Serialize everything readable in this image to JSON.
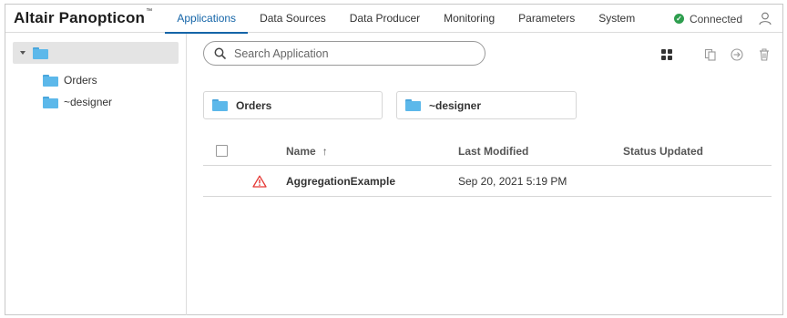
{
  "app": {
    "name": "Altair Panopticon",
    "trademark": "™"
  },
  "nav": {
    "items": [
      {
        "label": "Applications",
        "active": true
      },
      {
        "label": "Data Sources",
        "active": false
      },
      {
        "label": "Data Producer",
        "active": false
      },
      {
        "label": "Monitoring",
        "active": false
      },
      {
        "label": "Parameters",
        "active": false
      },
      {
        "label": "System",
        "active": false
      }
    ]
  },
  "status": {
    "label": "Connected",
    "color": "#2e9e4e"
  },
  "tree": {
    "root": {
      "label": ""
    },
    "items": [
      {
        "label": "Orders"
      },
      {
        "label": "~designer"
      }
    ]
  },
  "search": {
    "placeholder": "Search Application",
    "value": ""
  },
  "toolbar": {
    "icons": [
      "grid-view-icon",
      "copy-icon",
      "move-icon",
      "delete-icon"
    ]
  },
  "folders": [
    {
      "label": "Orders"
    },
    {
      "label": "~designer"
    }
  ],
  "table": {
    "columns": {
      "name": "Name",
      "sort_indicator": "↑",
      "last_modified": "Last Modified",
      "status_updated": "Status Updated"
    },
    "rows": [
      {
        "status_icon": "warning-icon",
        "name": "AggregationExample",
        "last_modified": "Sep 20, 2021 5:19 PM",
        "status_updated": ""
      }
    ]
  },
  "colors": {
    "accent": "#1565a8",
    "folder": "#5cb8ea",
    "warning": "#e53935"
  }
}
